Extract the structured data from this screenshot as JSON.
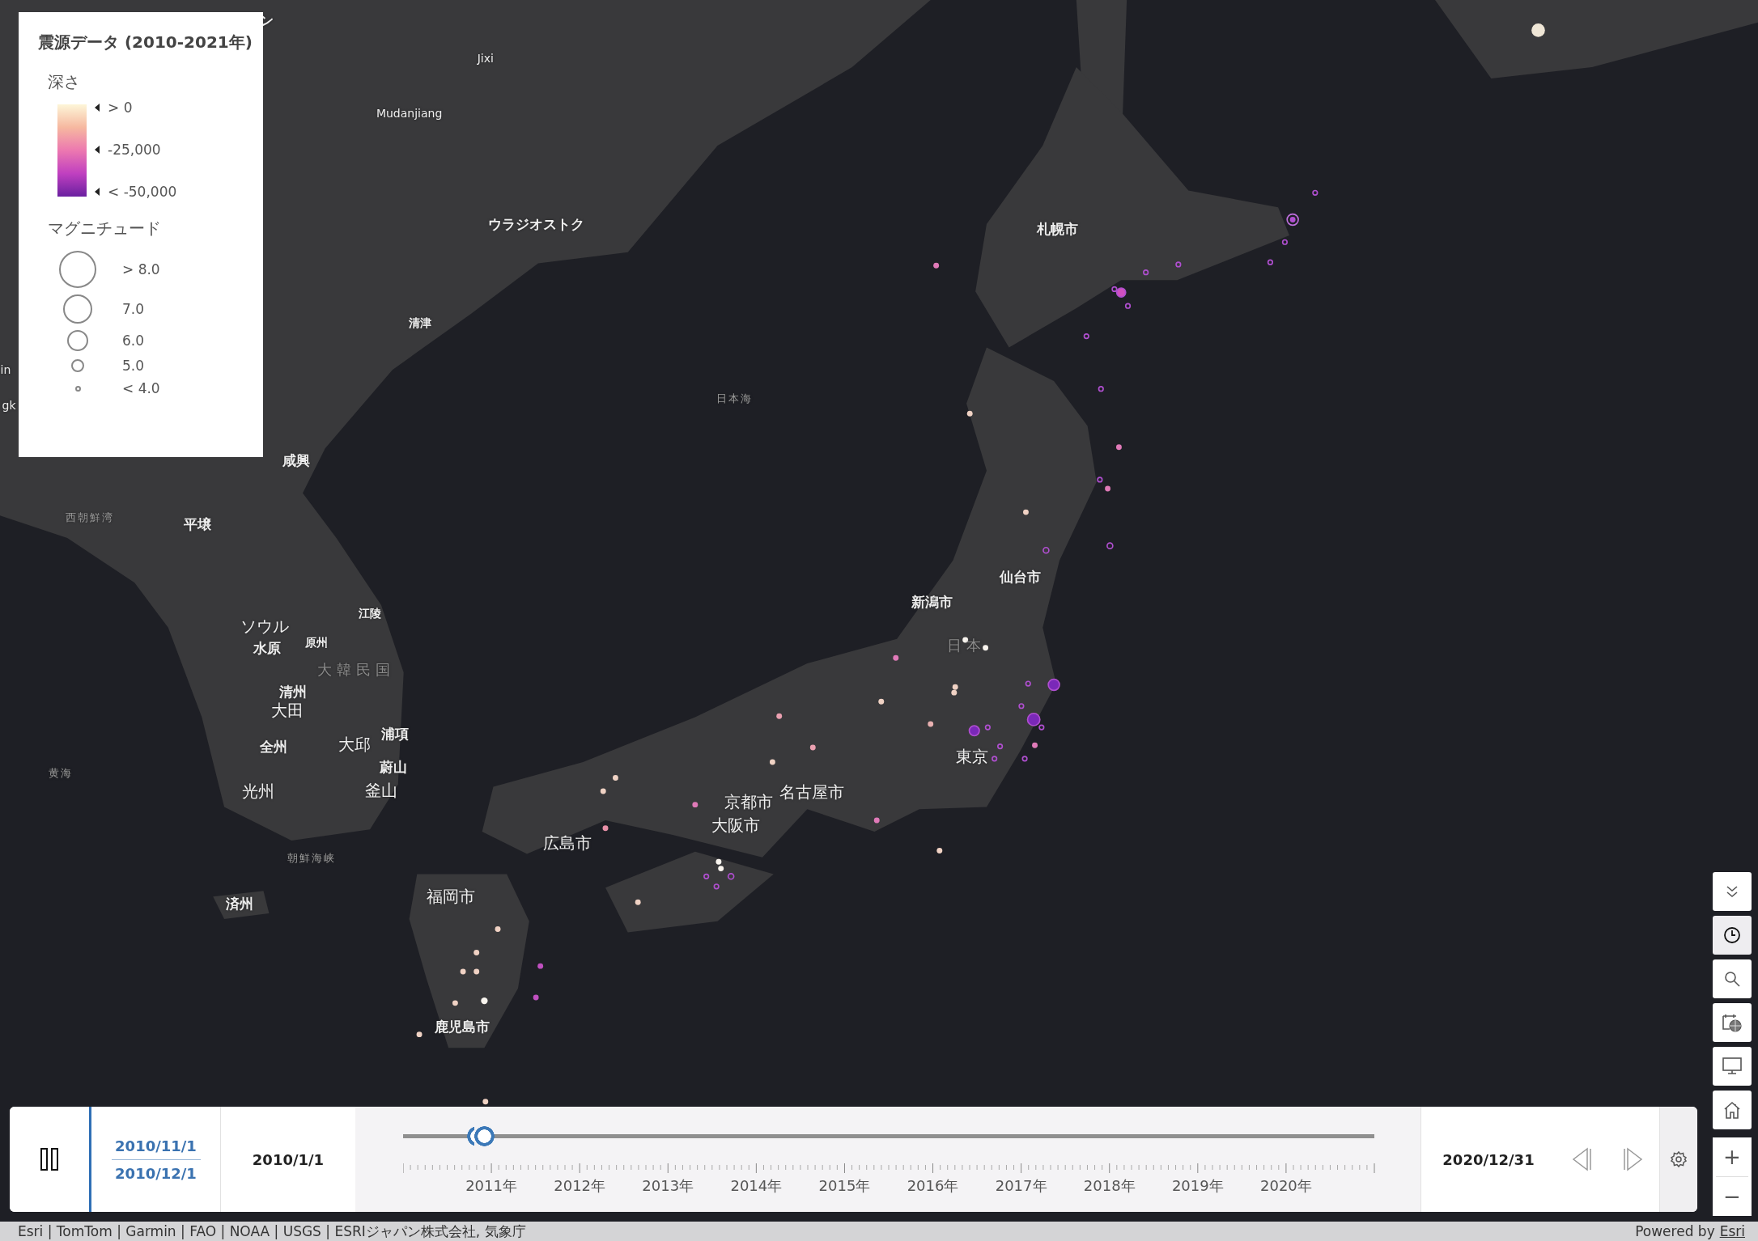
{
  "legend": {
    "title": "震源データ (2010-2021年)",
    "depth": {
      "heading": "深さ",
      "stops": [
        {
          "label": "> 0"
        },
        {
          "label": "-25,000"
        },
        {
          "label": "< -50,000"
        }
      ]
    },
    "magnitude": {
      "heading": "マグニチュード",
      "sizes": [
        {
          "label": "> 8.0"
        },
        {
          "label": "7.0"
        },
        {
          "label": "6.0"
        },
        {
          "label": "5.0"
        },
        {
          "label": "< 4.0"
        }
      ]
    }
  },
  "map": {
    "labels": [
      {
        "text": "ン",
        "kind": "city"
      },
      {
        "text": "Jixi",
        "kind": "latin"
      },
      {
        "text": "Mudanjiang",
        "kind": "latin"
      },
      {
        "text": "ウラジオストク",
        "kind": "city"
      },
      {
        "text": "清津",
        "kind": "small"
      },
      {
        "text": "札幌市",
        "kind": "city"
      },
      {
        "text": "日本海",
        "kind": "sea"
      },
      {
        "text": "in",
        "kind": "latin"
      },
      {
        "text": "gk",
        "kind": "latin"
      },
      {
        "text": "咸興",
        "kind": "city"
      },
      {
        "text": "西朝鮮湾",
        "kind": "sea"
      },
      {
        "text": "平壌",
        "kind": "city"
      },
      {
        "text": "仙台市",
        "kind": "city"
      },
      {
        "text": "新潟市",
        "kind": "city"
      },
      {
        "text": "江陵",
        "kind": "small"
      },
      {
        "text": "ソウル",
        "kind": "major"
      },
      {
        "text": "水原",
        "kind": "city"
      },
      {
        "text": "原州",
        "kind": "small"
      },
      {
        "text": "日本",
        "kind": "country"
      },
      {
        "text": "大韓民国",
        "kind": "country"
      },
      {
        "text": "清州",
        "kind": "city"
      },
      {
        "text": "大田",
        "kind": "major"
      },
      {
        "text": "浦項",
        "kind": "city"
      },
      {
        "text": "全州",
        "kind": "city"
      },
      {
        "text": "大邱",
        "kind": "major"
      },
      {
        "text": "蔚山",
        "kind": "city"
      },
      {
        "text": "黄海",
        "kind": "sea"
      },
      {
        "text": "光州",
        "kind": "major"
      },
      {
        "text": "釜山",
        "kind": "major"
      },
      {
        "text": "東京",
        "kind": "major"
      },
      {
        "text": "名古屋市",
        "kind": "major"
      },
      {
        "text": "京都市",
        "kind": "major"
      },
      {
        "text": "大阪市",
        "kind": "major"
      },
      {
        "text": "広島市",
        "kind": "major"
      },
      {
        "text": "朝鮮海峡",
        "kind": "sea"
      },
      {
        "text": "済州",
        "kind": "city"
      },
      {
        "text": "福岡市",
        "kind": "major"
      },
      {
        "text": "鹿児島市",
        "kind": "city"
      }
    ]
  },
  "time_slider": {
    "playing": true,
    "current_start": "2010/11/1",
    "current_end": "2010/12/1",
    "min_date": "2010/1/1",
    "max_date": "2020/12/31",
    "thumbs": [
      {
        "level": 0.076
      },
      {
        "level": 0.083
      }
    ],
    "ticks": [
      "2011年",
      "2012年",
      "2013年",
      "2014年",
      "2015年",
      "2016年",
      "2017年",
      "2018年",
      "2019年",
      "2020年"
    ]
  },
  "toolbar": [
    {
      "kind": "collapse",
      "selected": false
    },
    {
      "kind": "time",
      "selected": true
    },
    {
      "kind": "search",
      "selected": false
    },
    {
      "kind": "calendar",
      "selected": false
    },
    {
      "kind": "screen",
      "selected": false
    },
    {
      "kind": "home",
      "selected": false
    }
  ],
  "zoom": {
    "in": "+",
    "out": "−"
  },
  "attribution": {
    "text": "Esri | TomTom | Garmin | FAO | NOAA | USGS | ESRIジャパン株式会社, 気象庁",
    "powered_by": "Powered by",
    "link": "Esri"
  }
}
